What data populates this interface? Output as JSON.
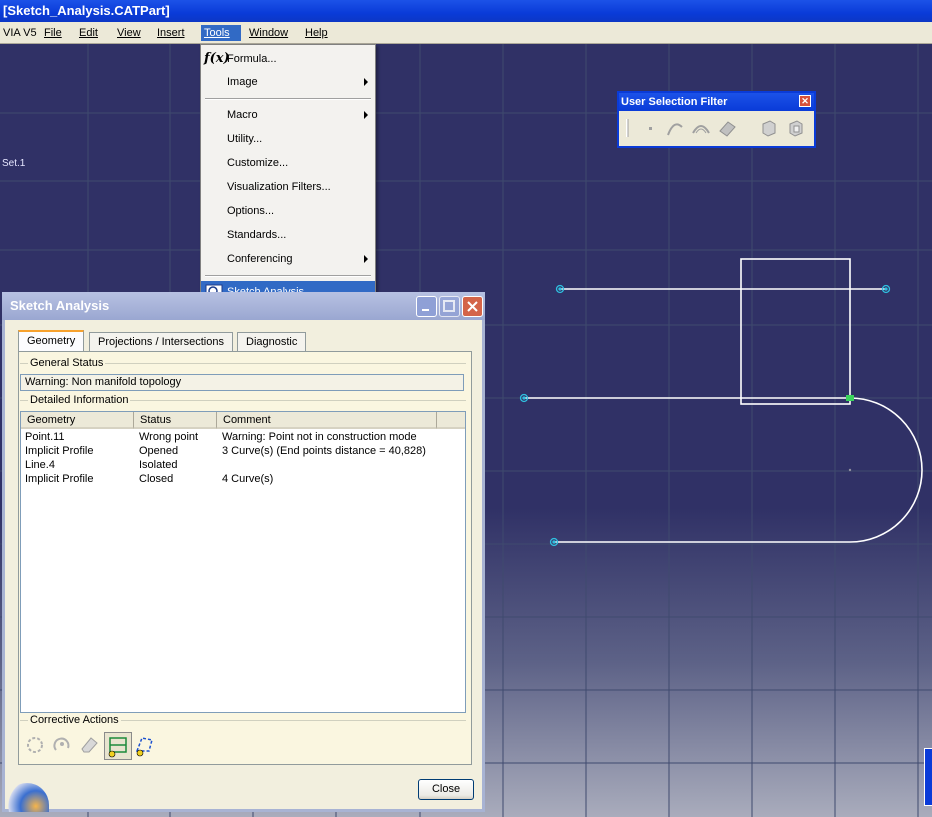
{
  "window": {
    "title": "[Sketch_Analysis.CATPart]"
  },
  "menubar": {
    "items": [
      {
        "label": "VIA V5"
      },
      {
        "label": "File"
      },
      {
        "label": "Edit"
      },
      {
        "label": "View"
      },
      {
        "label": "Insert"
      },
      {
        "label": "Tools"
      },
      {
        "label": "Window"
      },
      {
        "label": "Help"
      }
    ],
    "active": "Tools"
  },
  "tools_menu": {
    "items": [
      {
        "label": "Formula...",
        "submenu": false
      },
      {
        "label": "Image",
        "submenu": true
      },
      {
        "label": "Macro",
        "submenu": true
      },
      {
        "label": "Utility...",
        "submenu": false
      },
      {
        "label": "Customize...",
        "submenu": false
      },
      {
        "label": "Visualization Filters...",
        "submenu": false
      },
      {
        "label": "Options...",
        "submenu": false
      },
      {
        "label": "Standards...",
        "submenu": false
      },
      {
        "label": "Conferencing",
        "submenu": true
      },
      {
        "label": "Sketch Analysis",
        "submenu": false,
        "highlighted": true
      }
    ],
    "formula_icon_text": "f(x)"
  },
  "tree": {
    "set_label": "Set.1"
  },
  "user_selection_filter": {
    "title": "User Selection Filter"
  },
  "sketch_analysis": {
    "title": "Sketch Analysis",
    "tabs": [
      {
        "label": "Geometry",
        "selected": true
      },
      {
        "label": "Projections / Intersections",
        "selected": false
      },
      {
        "label": "Diagnostic",
        "selected": false
      }
    ],
    "general_status_label": "General Status",
    "general_status_value": "Warning: Non manifold topology",
    "detailed_info_label": "Detailed Information",
    "columns": [
      "Geometry",
      "Status",
      "Comment"
    ],
    "rows": [
      {
        "geometry": "Point.11",
        "status": "Wrong point",
        "comment": "Warning: Point not in construction mode"
      },
      {
        "geometry": "Implicit Profile",
        "status": "Opened",
        "comment": "3 Curve(s) (End points distance = 40,828)"
      },
      {
        "geometry": "Line.4",
        "status": "Isolated",
        "comment": ""
      },
      {
        "geometry": "Implicit Profile",
        "status": "Closed",
        "comment": "4 Curve(s)"
      }
    ],
    "corrective_actions_label": "Corrective Actions",
    "close_label": "Close"
  },
  "colors": {
    "titlebar": "#0a3bd8",
    "viewport": "#303166",
    "grid": "#3f4a6e",
    "highlight": "#316ac5",
    "sketch_line": "#ffffff",
    "point": "#2fc0e0"
  }
}
